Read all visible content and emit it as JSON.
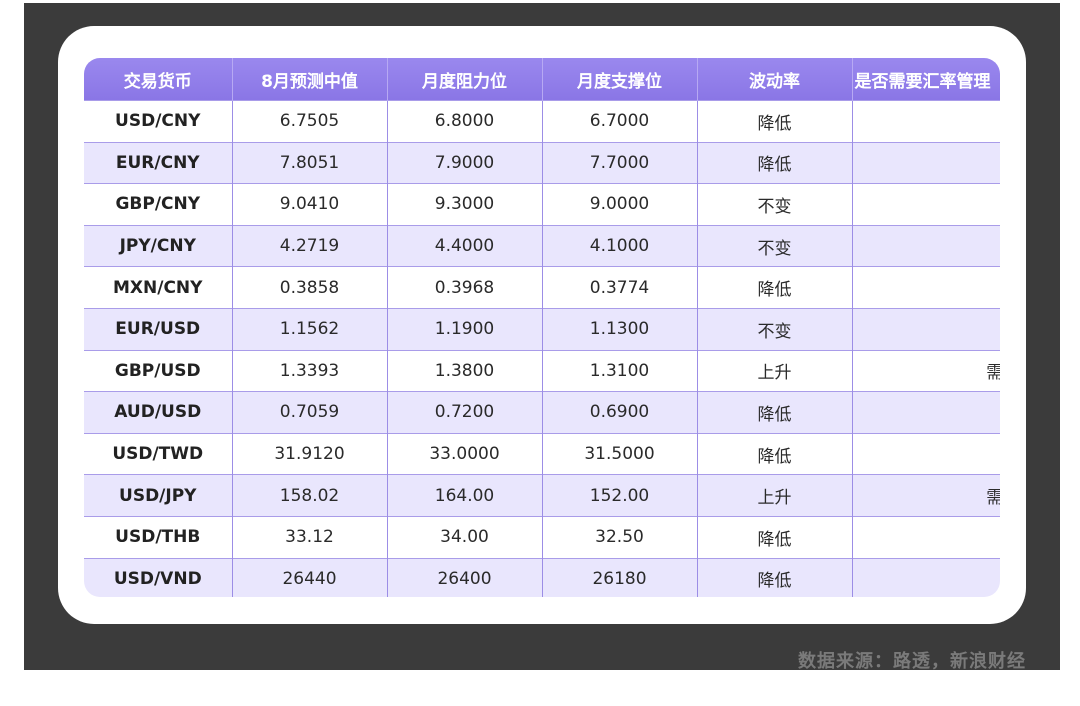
{
  "table": {
    "headers": [
      "交易货币",
      "8月预测中值",
      "月度阻力位",
      "月度支撑位",
      "波动率",
      "是否需要汇率管理"
    ],
    "rows": [
      [
        "USD/CNY",
        "6.7505",
        "6.8000",
        "6.7000",
        "降低",
        "-"
      ],
      [
        "EUR/CNY",
        "7.8051",
        "7.9000",
        "7.7000",
        "降低",
        "-"
      ],
      [
        "GBP/CNY",
        "9.0410",
        "9.3000",
        "9.0000",
        "不变",
        "-"
      ],
      [
        "JPY/CNY",
        "4.2719",
        "4.4000",
        "4.1000",
        "不变",
        "-"
      ],
      [
        "MXN/CNY",
        "0.3858",
        "0.3968",
        "0.3774",
        "降低",
        "-"
      ],
      [
        "EUR/USD",
        "1.1562",
        "1.1900",
        "1.1300",
        "不变",
        "-"
      ],
      [
        "GBP/USD",
        "1.3393",
        "1.3800",
        "1.3100",
        "上升",
        "需要"
      ],
      [
        "AUD/USD",
        "0.7059",
        "0.7200",
        "0.6900",
        "降低",
        "-"
      ],
      [
        "USD/TWD",
        "31.9120",
        "33.0000",
        "31.5000",
        "降低",
        "-"
      ],
      [
        "USD/JPY",
        "158.02",
        "164.00",
        "152.00",
        "上升",
        "需要"
      ],
      [
        "USD/THB",
        "33.12",
        "34.00",
        "32.50",
        "降低",
        "-"
      ],
      [
        "USD/VND",
        "26440",
        "26400",
        "26180",
        "降低",
        "-"
      ]
    ]
  },
  "source": "数据来源：路透，新浪财经",
  "colors": {
    "header_bg": "#8a76e6",
    "row_alt_bg": "#e9e6fd",
    "page_bg": "#3b3b3b"
  }
}
